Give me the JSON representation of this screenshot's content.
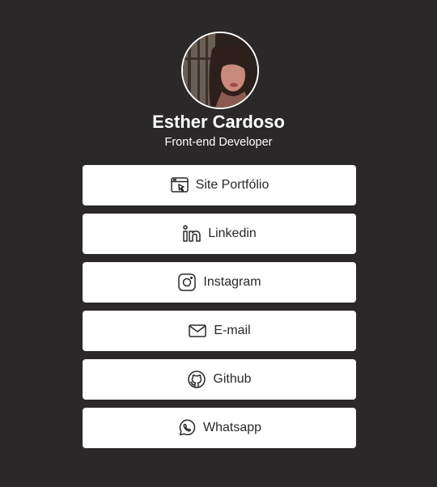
{
  "profile": {
    "name": "Esther Cardoso",
    "role": "Front-end Developer"
  },
  "links": [
    {
      "label": "Site Portfólio",
      "icon": "browser-cursor-icon"
    },
    {
      "label": "Linkedin",
      "icon": "linkedin-icon"
    },
    {
      "label": "Instagram",
      "icon": "instagram-icon"
    },
    {
      "label": "E-mail",
      "icon": "mail-icon"
    },
    {
      "label": "Github",
      "icon": "github-icon"
    },
    {
      "label": "Whatsapp",
      "icon": "whatsapp-icon"
    }
  ],
  "colors": {
    "background": "#2b2829",
    "button": "#ffffff",
    "text_dark": "#2b2829",
    "text_light": "#ffffff"
  }
}
